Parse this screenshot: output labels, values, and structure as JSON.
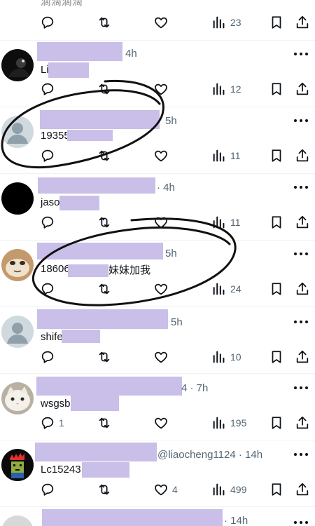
{
  "top_partial": {
    "text": "滴滴滴滴",
    "views": "23"
  },
  "tweets": [
    {
      "time": "4h",
      "body_start": "Li",
      "replies": "",
      "retweets": "",
      "likes": "",
      "views": "12"
    },
    {
      "time": "5h",
      "body_start": "19355",
      "replies": "",
      "retweets": "",
      "likes": "",
      "views": "11"
    },
    {
      "time": "· 4h",
      "body_start": "jaso",
      "replies": "",
      "retweets": "",
      "likes": "",
      "views": "11"
    },
    {
      "time": "5h",
      "body_start": "18606",
      "body_end": "妹妹加我",
      "replies": "",
      "retweets": "",
      "likes": "",
      "views": "24"
    },
    {
      "time": "5h",
      "body_start": "shife",
      "replies": "",
      "retweets": "",
      "likes": "",
      "views": "10"
    },
    {
      "time": "4 · 7h",
      "body_start": "wsgsb",
      "replies": "1",
      "retweets": "",
      "likes": "",
      "views": "195"
    },
    {
      "time": "@liaocheng1124 · 14h",
      "body_start": "Lc15243",
      "replies": "",
      "retweets": "",
      "likes": "4",
      "views": "499"
    },
    {
      "time": "· 14h",
      "body_start": "",
      "replies": "",
      "retweets": "",
      "likes": "",
      "views": ""
    }
  ],
  "icons": {
    "reply": "reply-icon",
    "retweet": "retweet-icon",
    "like": "like-icon",
    "views": "views-icon",
    "bookmark": "bookmark-icon",
    "share": "share-icon",
    "more": "more-icon"
  },
  "colors": {
    "redaction": "#c9bfe8",
    "text": "#0f1419",
    "muted": "#536471",
    "annotation": "#111111"
  }
}
